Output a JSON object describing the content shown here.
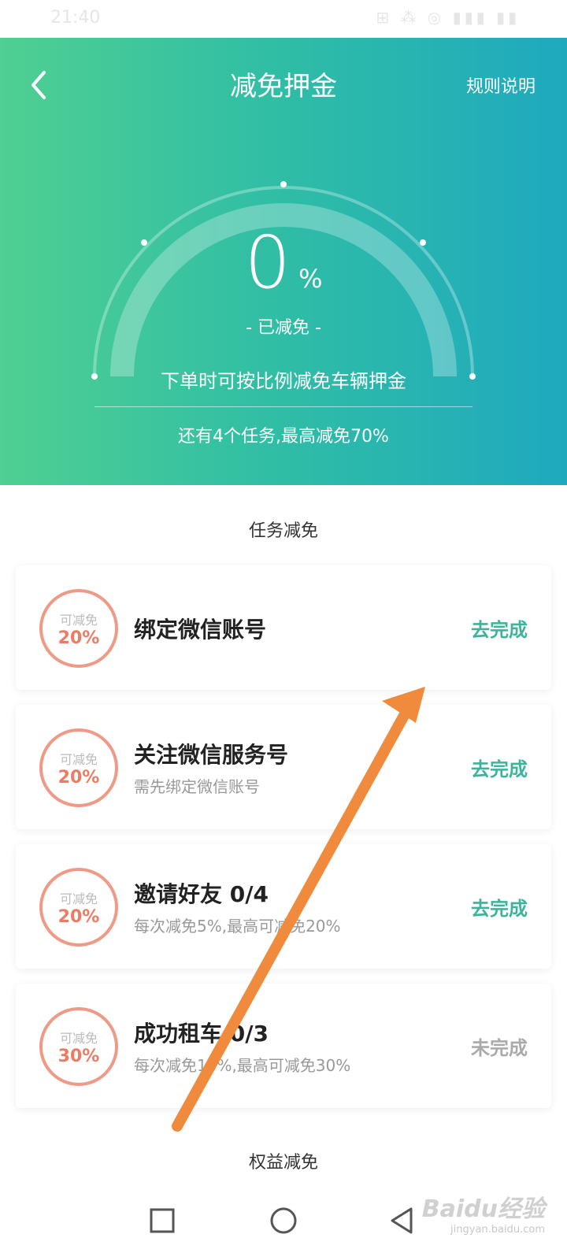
{
  "status_bar": {
    "time": "21:40",
    "icons": "⊞ ⁂ ◎ ▮▮▮ ▮▮"
  },
  "header": {
    "title": "减免押金",
    "rules_label": "规则说明",
    "percent_value": "0",
    "percent_sign": "%",
    "reduced_label": "- 已减免 -",
    "description": "下单时可按比例减免车辆押金",
    "remaining_tasks": "还有4个任务,最高减免70%",
    "gauge_fill_percent": 0
  },
  "tasks_section_title": "任务减免",
  "tasks": [
    {
      "badge_label": "可减免",
      "badge_value": "20%",
      "title": "绑定微信账号",
      "subtitle": "",
      "action": "去完成",
      "done": false
    },
    {
      "badge_label": "可减免",
      "badge_value": "20%",
      "title": "关注微信服务号",
      "subtitle": "需先绑定微信账号",
      "action": "去完成",
      "done": false
    },
    {
      "badge_label": "可减免",
      "badge_value": "20%",
      "title": "邀请好友 0/4",
      "subtitle": "每次减免5%,最高可减免20%",
      "action": "去完成",
      "done": false
    },
    {
      "badge_label": "可减免",
      "badge_value": "30%",
      "title": "成功租车 0/3",
      "subtitle": "每次减免10%,最高可减免30%",
      "action": "未完成",
      "done": true
    }
  ],
  "benefits_section_title": "权益减免",
  "watermark": {
    "brand": "Baidu经验",
    "url": "jingyan.baidu.com"
  },
  "colors": {
    "accent": "#3cb49b",
    "badge": "#ec7b63",
    "arrow": "#f08a3c"
  }
}
